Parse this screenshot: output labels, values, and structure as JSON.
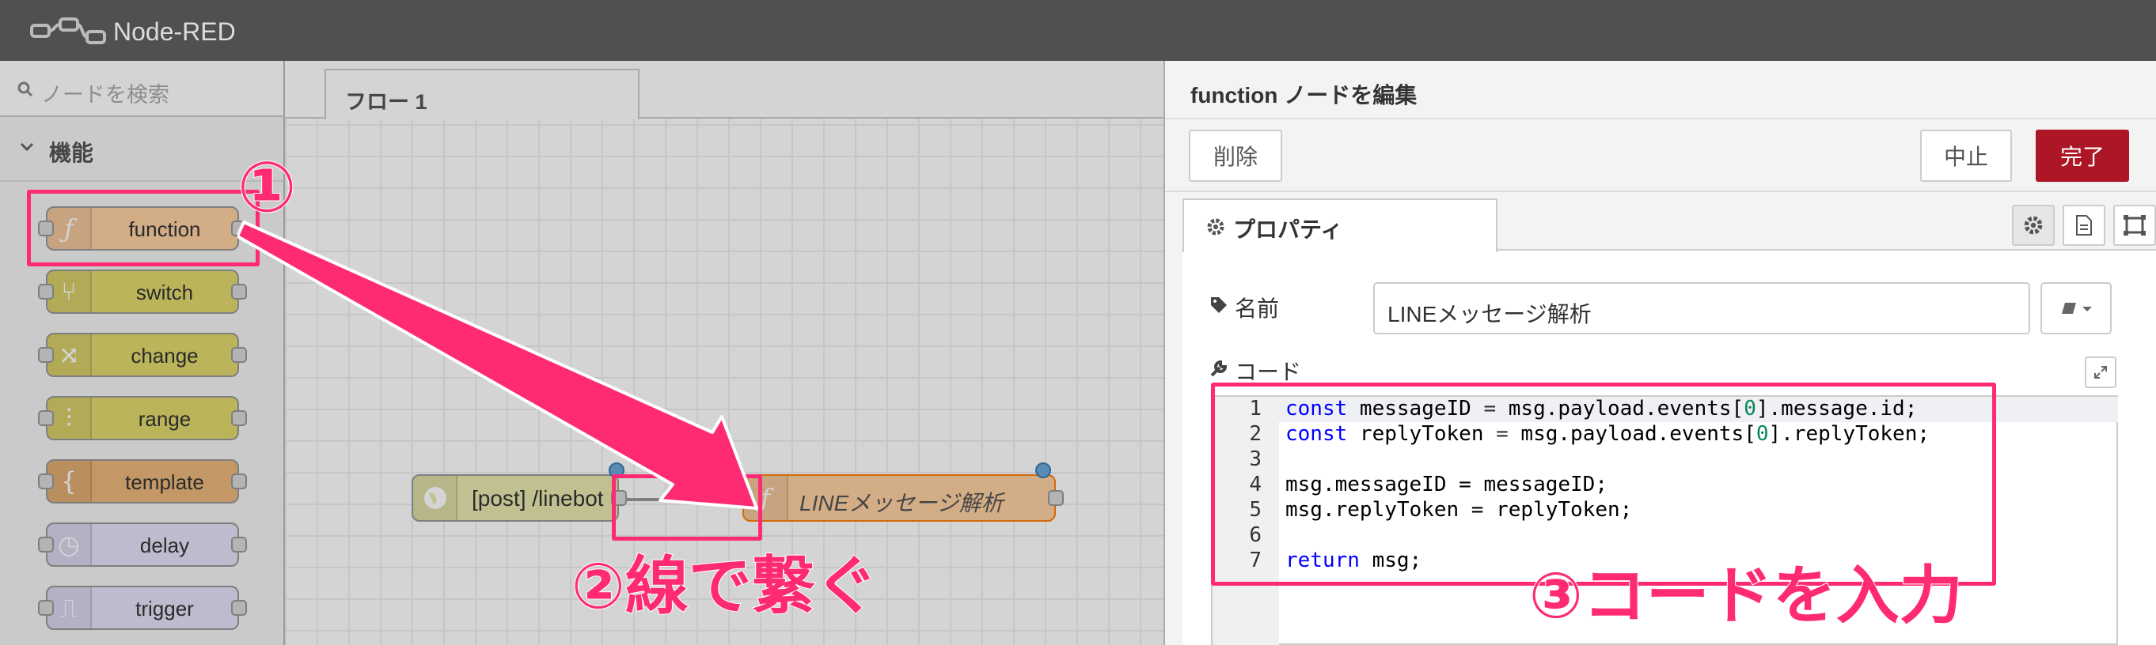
{
  "header": {
    "app_title": "Node-RED"
  },
  "palette": {
    "search_placeholder": "ノードを検索",
    "category_label": "機能",
    "nodes": [
      {
        "label": "function",
        "color": "#fdd0a2",
        "icon": "function-icon"
      },
      {
        "label": "switch",
        "color": "#e2d96e",
        "icon": "switch-icon"
      },
      {
        "label": "change",
        "color": "#e2d96e",
        "icon": "change-icon"
      },
      {
        "label": "range",
        "color": "#e2d96e",
        "icon": "range-icon"
      },
      {
        "label": "template",
        "color": "#ebb77b",
        "icon": "template-icon"
      },
      {
        "label": "delay",
        "color": "#e6e0f8",
        "icon": "delay-icon"
      },
      {
        "label": "trigger",
        "color": "#e6e0f8",
        "icon": "trigger-icon"
      }
    ]
  },
  "workspace": {
    "tab_label": "フロー 1",
    "http_node_label": "[post] /linebot",
    "function_node_label": "LINEメッセージ解析"
  },
  "tray": {
    "title": "function ノードを編集",
    "delete_label": "削除",
    "cancel_label": "中止",
    "done_label": "完了",
    "properties_tab": "プロパティ",
    "name_label": "名前",
    "name_value": "LINEメッセージ解析",
    "code_label": "コード",
    "code_lines": [
      "const messageID = msg.payload.events[0].message.id;",
      "const replyToken = msg.payload.events[0].replyToken;",
      "",
      "msg.messageID = messageID;",
      "msg.replyToken = replyToken;",
      "",
      "return msg;"
    ],
    "line_numbers": [
      "1",
      "2",
      "3",
      "4",
      "5",
      "6",
      "7"
    ]
  },
  "annotations": {
    "step1": "①",
    "step2": "②線で繋ぐ",
    "step3": "③コードを入力"
  },
  "colors": {
    "accent_red": "#ad1625",
    "annotation_pink": "#ff2a74",
    "header": "#505050"
  }
}
